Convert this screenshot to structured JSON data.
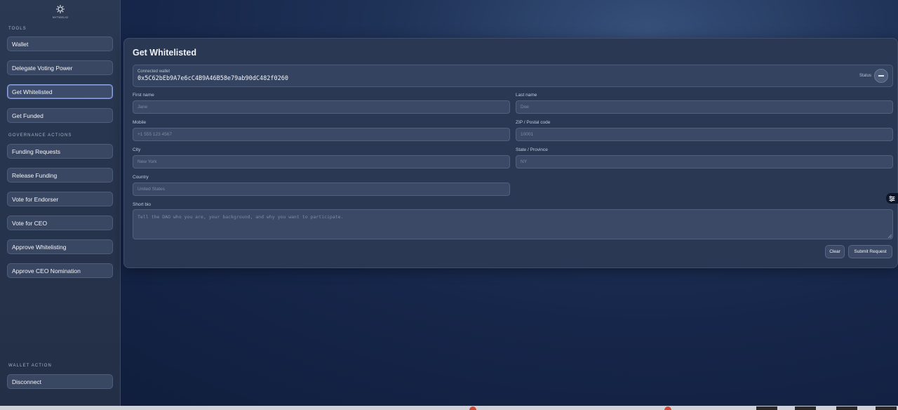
{
  "sidebar": {
    "logo_text": "NYTIOS.IO",
    "tools_label": "TOOLS",
    "tools": [
      {
        "label": "Wallet"
      },
      {
        "label": "Delegate Voting Power"
      },
      {
        "label": "Get Whitelisted"
      },
      {
        "label": "Get Funded"
      }
    ],
    "governance_label": "GOVERNANCE ACTIONS",
    "governance": [
      {
        "label": "Funding Requests"
      },
      {
        "label": "Release Funding"
      },
      {
        "label": "Vote for Endorser"
      },
      {
        "label": "Vote for CEO"
      },
      {
        "label": "Approve Whitelisting"
      },
      {
        "label": "Approve CEO Nomination"
      }
    ],
    "wallet_action_label": "WALLET ACTION",
    "disconnect_label": "Disconnect"
  },
  "form": {
    "title": "Get Whitelisted",
    "wallet": {
      "label": "Connected wallet",
      "address": "0x5C62bEb9A7e6cC4B9A46B58e79ab90dC482f0260",
      "status_label": "Status"
    },
    "first_name": {
      "label": "First name",
      "placeholder": "Jane"
    },
    "last_name": {
      "label": "Last name",
      "placeholder": "Doe"
    },
    "mobile": {
      "label": "Mobile",
      "placeholder": "+1 555 123 4567"
    },
    "zip": {
      "label": "ZIP / Postal code",
      "placeholder": "10001"
    },
    "city": {
      "label": "City",
      "placeholder": "New York"
    },
    "state": {
      "label": "State / Province",
      "placeholder": "NY"
    },
    "country": {
      "label": "Country",
      "placeholder": "United States"
    },
    "bio": {
      "label": "Short bio",
      "placeholder": "Tell the DAO who you are, your background, and why you want to participate."
    },
    "clear_label": "Clear",
    "submit_label": "Submit Request"
  },
  "colors": {
    "accent": "#8aa3e0",
    "sidebar_bg": "#2b3953",
    "card_bg": "#2a3854"
  }
}
